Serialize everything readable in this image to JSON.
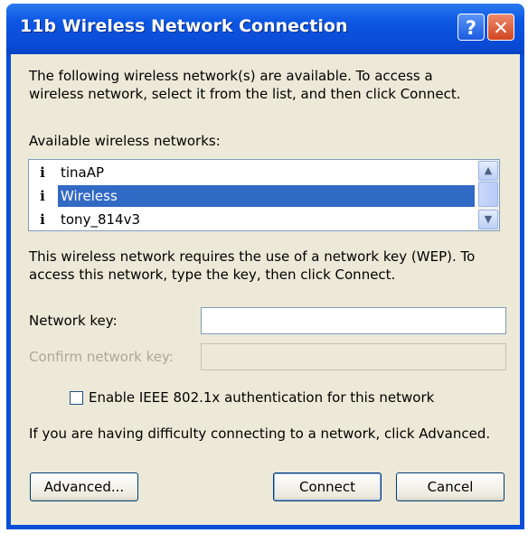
{
  "window": {
    "title": "11b Wireless Network Connection",
    "help_label": "?",
    "close_label": "✕"
  },
  "intro": {
    "line1": "The following wireless network(s) are available. To access a",
    "line2": "wireless network, select it from the list, and then click Connect."
  },
  "networks": {
    "label": "Available wireless networks:",
    "items": [
      {
        "label": "tinaAP",
        "icon": "wireless-antenna-icon",
        "selected": false
      },
      {
        "label": "Wireless",
        "icon": "wireless-antenna-icon",
        "selected": true
      },
      {
        "label": "tony_814v3",
        "icon": "wireless-antenna-icon",
        "selected": false
      }
    ]
  },
  "wep_note": {
    "line1": "This wireless network requires the use of a network key (WEP). To",
    "line2": "access this network, type the key, then click Connect."
  },
  "network_key": {
    "label": "Network key:",
    "value": ""
  },
  "confirm_key": {
    "label": "Confirm network key:",
    "value": ""
  },
  "ieee": {
    "label": "Enable IEEE 802.1x authentication for this network",
    "checked": false
  },
  "advanced_hint": "If you are having difficulty connecting to a network, click Advanced.",
  "buttons": {
    "advanced": "Advanced...",
    "connect": "Connect",
    "cancel": "Cancel"
  },
  "colors": {
    "titlebar": "#0a4fd8",
    "selection": "#316ac5",
    "dialog_bg": "#ece9d8"
  }
}
